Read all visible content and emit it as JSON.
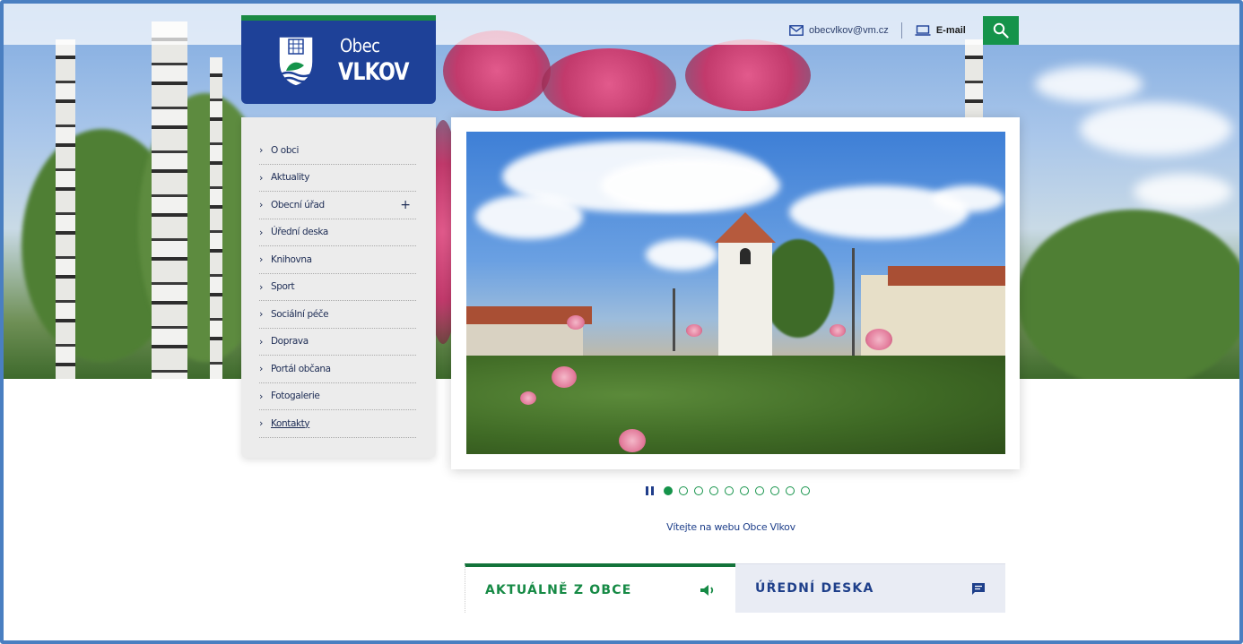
{
  "header": {
    "logo_line1": "Obec",
    "logo_line2": "VLKOV",
    "contact_email": "obecvlkov@vm.cz",
    "email_link_label": "E-mail"
  },
  "icons": {
    "mail": "envelope-icon",
    "email_link": "laptop-icon",
    "search": "search-icon",
    "pause": "pause-icon",
    "speaker": "speaker-icon",
    "chat": "message-icon"
  },
  "menu": {
    "items": [
      {
        "label": "O obci"
      },
      {
        "label": "Aktuality"
      },
      {
        "label": "Obecní úřad",
        "expandable": "+"
      },
      {
        "label": "Úřední deska"
      },
      {
        "label": "Knihovna"
      },
      {
        "label": "Sport"
      },
      {
        "label": "Sociální péče"
      },
      {
        "label": "Doprava"
      },
      {
        "label": "Portál občana"
      },
      {
        "label": "Fotogalerie"
      },
      {
        "label": "Kontakty"
      }
    ]
  },
  "slider": {
    "caption": "Vítejte na webu Obce Vlkov",
    "slide_count": 10,
    "active_index": 0
  },
  "tabs": [
    {
      "label": "AKTUÁLNĚ Z OBCE",
      "active": true
    },
    {
      "label": "ÚŘEDNÍ DESKA",
      "active": false
    }
  ],
  "colors": {
    "brand_blue": "#1e4198",
    "brand_green": "#15934a",
    "frame_blue": "#4a7fc1"
  }
}
